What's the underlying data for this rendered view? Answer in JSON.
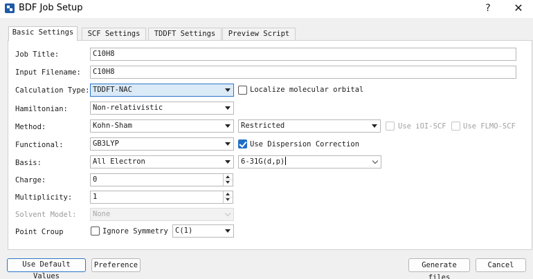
{
  "window": {
    "title": "BDF Job Setup",
    "help_label": "?",
    "close_label": "✕"
  },
  "tabs": [
    {
      "label": "Basic Settings"
    },
    {
      "label": "SCF Settings"
    },
    {
      "label": "TDDFT Settings"
    },
    {
      "label": "Preview Script"
    }
  ],
  "form": {
    "job_title": {
      "label": "Job Title:",
      "value": "C10H8"
    },
    "input_filename": {
      "label": "Input Filename:",
      "value": "C10H8"
    },
    "calculation_type": {
      "label": "Calculation Type:",
      "value": "TDDFT-NAC"
    },
    "localize_orbital": {
      "label": "Localize molecular orbital",
      "checked": false
    },
    "hamiltonian": {
      "label": "Hamiltonian:",
      "value": "Non-relativistic"
    },
    "method": {
      "label": "Method:",
      "value": "Kohn-Sham"
    },
    "restriction": {
      "value": "Restricted"
    },
    "use_ioi_scf": {
      "label": "Use iOI-SCF",
      "checked": false
    },
    "use_flmo_scf": {
      "label": "Use FLMO-SCF",
      "checked": false
    },
    "functional": {
      "label": "Functional:",
      "value": "GB3LYP"
    },
    "use_dispersion": {
      "label": "Use Dispersion Correction",
      "checked": true
    },
    "basis": {
      "label": "Basis:",
      "value": "All Electron"
    },
    "basis_set": {
      "value": "6-31G(d,p)"
    },
    "charge": {
      "label": "Charge:",
      "value": "0"
    },
    "multiplicity": {
      "label": "Multiplicity:",
      "value": "1"
    },
    "solvent_model": {
      "label": "Solvent Model:",
      "value": "None"
    },
    "point_group": {
      "label": "Point Croup",
      "value": "C(1)"
    },
    "ignore_symmetry": {
      "label": "Ignore Symmetry",
      "checked": false
    }
  },
  "buttons": {
    "use_default": "Use Default Values",
    "preference": "Preference",
    "generate": "Generate files",
    "cancel": "Cancel"
  }
}
